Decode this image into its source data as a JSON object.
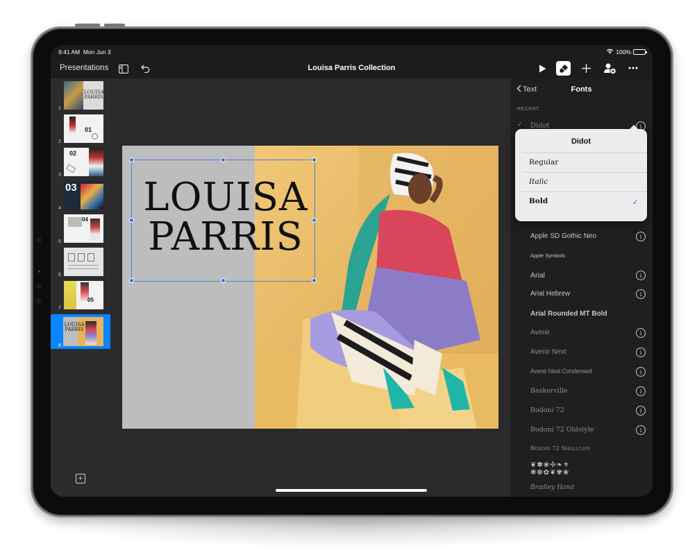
{
  "status": {
    "time": "9:41 AM",
    "date": "Mon Jun 3",
    "battery": "100%"
  },
  "toolbar": {
    "presentations": "Presentations",
    "title": "Louisa Parris Collection"
  },
  "sidebar": {
    "slides": [
      {
        "num": "1",
        "text": "LOUISA PARRIS"
      },
      {
        "num": "2",
        "text": "01"
      },
      {
        "num": "3",
        "text": "02"
      },
      {
        "num": "4",
        "text": "03"
      },
      {
        "num": "5",
        "text": "04"
      },
      {
        "num": "6",
        "text": ""
      },
      {
        "num": "7",
        "text": "05"
      },
      {
        "num": "8",
        "text": "LOUISA PARRIS"
      }
    ],
    "selected_index": 7
  },
  "slide": {
    "title_line1": "LOUISA",
    "title_line2": "PARRIS"
  },
  "panel": {
    "back_label": "Text",
    "title": "Fonts",
    "section": "RECENT",
    "recent_font": "Didot",
    "fonts": [
      "Apple SD Gothic Neo",
      "Apple Symbols",
      "Arial",
      "Arial Hebrew",
      "Arial Rounded MT Bold",
      "Avenir",
      "Avenir Next",
      "Avenir Next Condensed",
      "Baskerville",
      "Bodoni 72",
      "Bodoni 72 Oldstyle",
      "Bodoni 72 Smallcaps",
      "Bradley Hand"
    ]
  },
  "popover": {
    "title": "Didot",
    "styles": [
      "Regular",
      "Italic",
      "Bold"
    ],
    "selected": "Bold"
  },
  "colors": {
    "accent": "#0a84ff",
    "selection_handle": "#2f6fe0",
    "photo_bg": "#e6b45c"
  }
}
